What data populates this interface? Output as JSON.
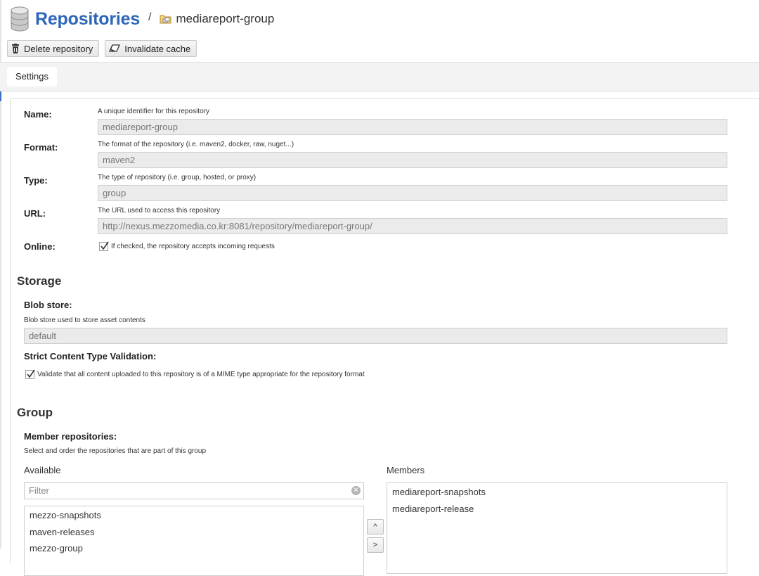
{
  "header": {
    "title": "Repositories",
    "separator": "/",
    "repo_name": "mediareport-group"
  },
  "toolbar": {
    "delete_label": "Delete repository",
    "invalidate_label": "Invalidate cache"
  },
  "tabs": [
    {
      "label": "Settings",
      "active": true
    }
  ],
  "settings": {
    "name": {
      "label": "Name:",
      "help": "A unique identifier for this repository",
      "value": "mediareport-group"
    },
    "format": {
      "label": "Format:",
      "help": "The format of the repository (i.e. maven2, docker, raw, nuget...)",
      "value": "maven2"
    },
    "type": {
      "label": "Type:",
      "help": "The type of repository (i.e. group, hosted, or proxy)",
      "value": "group"
    },
    "url": {
      "label": "URL:",
      "help": "The URL used to access this repository",
      "value": "http://nexus.mezzomedia.co.kr:8081/repository/mediareport-group/"
    },
    "online": {
      "label": "Online:",
      "checkbox_label": "If checked, the repository accepts incoming requests",
      "checked": true
    }
  },
  "storage": {
    "heading": "Storage",
    "blob_label": "Blob store:",
    "blob_help": "Blob store used to store asset contents",
    "blob_value": "default",
    "strict_label": "Strict Content Type Validation:",
    "strict_checkbox_label": "Validate that all content uploaded to this repository is of a MIME type appropriate for the repository format",
    "strict_checked": true
  },
  "group": {
    "heading": "Group",
    "members_label": "Member repositories:",
    "members_help": "Select and order the repositories that are part of this group",
    "available_label": "Available",
    "members_list_label": "Members",
    "filter_placeholder": "Filter",
    "available": [
      "mezzo-snapshots",
      "maven-releases",
      "mezzo-group"
    ],
    "members": [
      "mediareport-snapshots",
      "mediareport-release"
    ],
    "move_up": "^",
    "move_right": ">"
  },
  "colors": {
    "title": "#2e66b9",
    "field_bg": "#ebebeb",
    "accent": "#3b6fc4"
  }
}
